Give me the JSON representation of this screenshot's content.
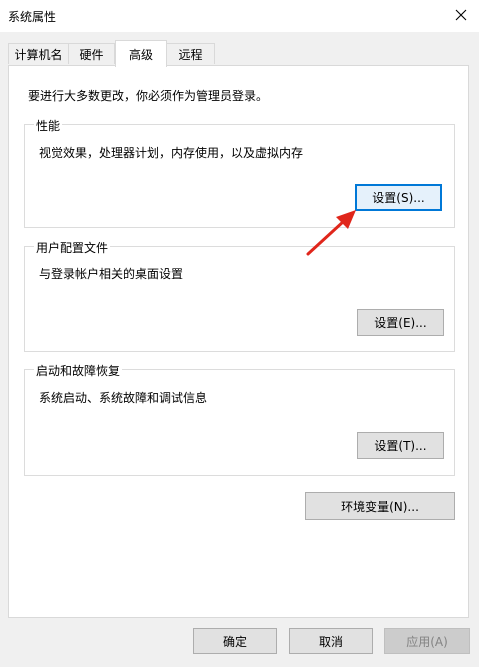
{
  "window": {
    "title": "系统属性",
    "close_icon": "close-icon"
  },
  "tabs": [
    {
      "label": "计算机名",
      "active": false
    },
    {
      "label": "硬件",
      "active": false
    },
    {
      "label": "高级",
      "active": true
    },
    {
      "label": "远程",
      "active": false
    }
  ],
  "admin_notice": "要进行大多数更改，你必须作为管理员登录。",
  "groups": {
    "performance": {
      "title": "性能",
      "description": "视觉效果，处理器计划，内存使用，以及虚拟内存",
      "button": "设置(S)..."
    },
    "user_profiles": {
      "title": "用户配置文件",
      "description": "与登录帐户相关的桌面设置",
      "button": "设置(E)..."
    },
    "startup_recovery": {
      "title": "启动和故障恢复",
      "description": "系统启动、系统故障和调试信息",
      "button": "设置(T)..."
    }
  },
  "env_button": "环境变量(N)...",
  "footer": {
    "ok": "确定",
    "cancel": "取消",
    "apply": "应用(A)"
  },
  "annotation_color": "#e0261b"
}
